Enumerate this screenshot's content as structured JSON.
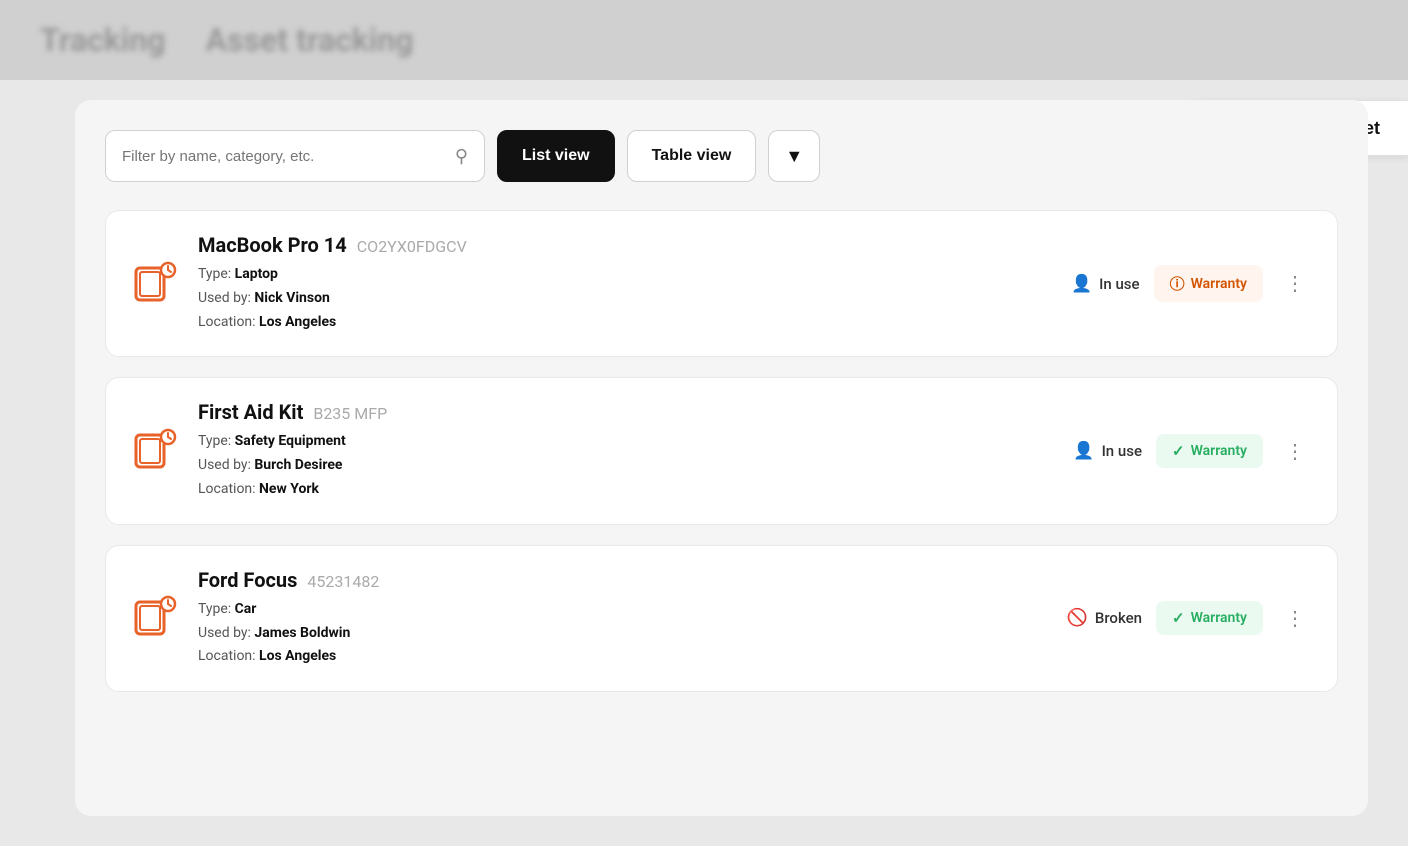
{
  "topBlur": {
    "text1": "Tracking",
    "text2": "Asset tracking"
  },
  "toolbar": {
    "searchPlaceholder": "Filter by name, category, etc.",
    "listViewLabel": "List view",
    "tableViewLabel": "Table view"
  },
  "addAsset": {
    "label": "Add new asset"
  },
  "assets": [
    {
      "id": "asset-1",
      "name": "MacBook Pro 14",
      "code": "CO2YX0FDGCV",
      "typeLabel": "Type:",
      "typeValue": "Laptop",
      "usedByLabel": "Used by:",
      "usedByValue": "Nick Vinson",
      "locationLabel": "Location:",
      "locationValue": "Los Angeles",
      "status": "In use",
      "statusType": "in-use",
      "warrantyLabel": "Warranty",
      "warrantyType": "warning"
    },
    {
      "id": "asset-2",
      "name": "First Aid Kit",
      "code": "B235 MFP",
      "typeLabel": "Type:",
      "typeValue": "Safety Equipment",
      "usedByLabel": "Used by:",
      "usedByValue": "Burch Desiree",
      "locationLabel": "Location:",
      "locationValue": "New York",
      "status": "In use",
      "statusType": "in-use",
      "warrantyLabel": "Warranty",
      "warrantyType": "success"
    },
    {
      "id": "asset-3",
      "name": "Ford Focus",
      "code": "45231482",
      "typeLabel": "Type:",
      "typeValue": "Car",
      "usedByLabel": "Used by:",
      "usedByValue": "James Boldwin",
      "locationLabel": "Location:",
      "locationValue": "Los Angeles",
      "status": "Broken",
      "statusType": "broken",
      "warrantyLabel": "Warranty",
      "warrantyType": "success"
    }
  ]
}
